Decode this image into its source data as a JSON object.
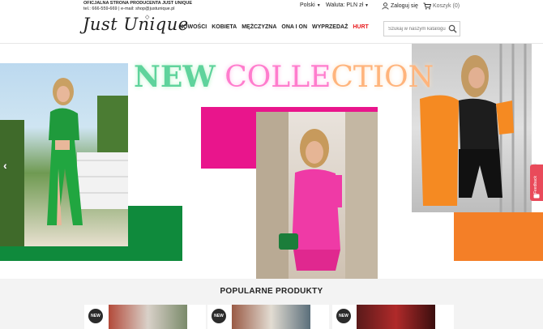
{
  "topbar": {
    "line1": "OFICJALNA STRONA PRODUCENTA JUST UNIQUE",
    "line2": "tel.: 666-559-669 | e-mail: shop@justunique.pl",
    "language": "Polski",
    "currency": "Waluta: PLN zł",
    "login": "Zaloguj się",
    "cart": "Koszyk (0)"
  },
  "header": {
    "logo": "Just Unique",
    "nav": [
      "NOWOŚCI",
      "KOBIETA",
      "MĘŻCZYZNA",
      "ONA I ON",
      "WYPRZEDAŻ",
      "HURT"
    ],
    "search_placeholder": "Szukaj w naszym katalogu"
  },
  "hero": {
    "headline_1": "NEW",
    "headline_2": "COLLE",
    "headline_3": "CTION",
    "colors": {
      "green": "#0f8a3c",
      "pink": "#e9158c",
      "orange": "#f47f27"
    }
  },
  "feedback": "Feedback",
  "popular": {
    "title": "POPULARNE PRODUKTY",
    "badges": [
      "NEW",
      "NEW",
      "NEW"
    ]
  }
}
